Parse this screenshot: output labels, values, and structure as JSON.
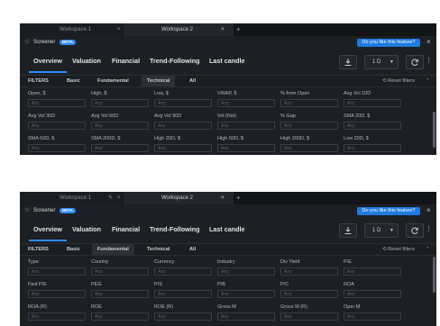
{
  "shared": {
    "workspace1": "Workspace 1",
    "workspace2": "Workspace 2",
    "plus": "+",
    "close": "×",
    "star": "☆",
    "title": "Screener",
    "beta": "BETA",
    "feedback": "Do you like this feature?",
    "tabs": [
      "Overview",
      "Valuation",
      "Financial",
      "Trend-Following",
      "Last candle"
    ],
    "period": "1 D",
    "filters": "FILTERS",
    "filter_tabs": [
      "Basic",
      "Fundamental",
      "Technical",
      "All"
    ],
    "reset": "Reset filters",
    "any": "Any"
  },
  "panel1": {
    "selected_filter_tab": "Technical",
    "fields": [
      "Open, $",
      "High, $",
      "Low, $",
      "VWAP, $",
      "% from Open",
      "Avg Vol 10D",
      "Avg Vol 30D",
      "Avg Vol 60D",
      "Avg Vol 90D",
      "Vol (Rel)",
      "% Gap",
      "SMA 20D, $",
      "SMA 50D, $",
      "SMA 200D, $",
      "High 20D, $",
      "High 50D, $",
      "High 200D, $",
      "Low 20D, $"
    ]
  },
  "panel2": {
    "selected_filter_tab": "Fundamental",
    "fields": [
      "Type",
      "Country",
      "Currency",
      "Industry",
      "Div Yield",
      "P/E",
      "Fwd P/E",
      "PEG",
      "P/S",
      "P/B",
      "P/C",
      "ROA",
      "ROA (R)",
      "ROE",
      "ROE (R)",
      "Gross M",
      "Gross M (R)",
      "Oper M"
    ]
  },
  "colors": {
    "accent": "#2e8bff",
    "panel_bg": "#1c1f24"
  },
  "icons": [
    "star-icon",
    "close-icon",
    "download-icon",
    "chevron-down-icon",
    "refresh-icon",
    "more-vertical-icon",
    "chevron-up-icon",
    "pencil-icon",
    "reset-filters-icon"
  ]
}
